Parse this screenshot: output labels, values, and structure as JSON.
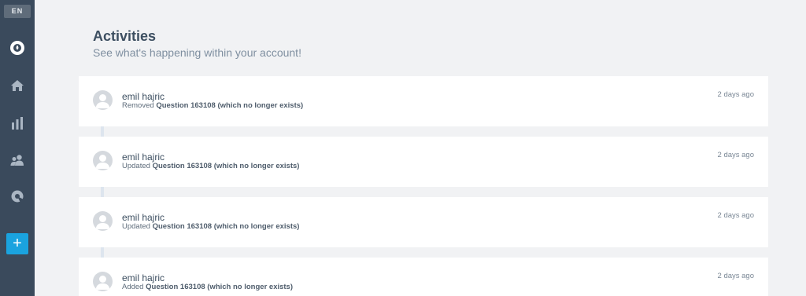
{
  "sidebar": {
    "lang": "EN",
    "items": [
      {
        "icon": "logo-icon"
      },
      {
        "icon": "home-icon"
      },
      {
        "icon": "bar-chart-icon"
      },
      {
        "icon": "users-icon"
      },
      {
        "icon": "settings-icon"
      }
    ],
    "add_label": "+"
  },
  "header": {
    "title": "Activities",
    "subtitle": "See what's happening within your account!"
  },
  "activities": [
    {
      "user": "emil hajric",
      "action": "Removed",
      "target": "Question 163108 (which no longer exists)",
      "time": "2 days ago"
    },
    {
      "user": "emil hajric",
      "action": "Updated",
      "target": "Question 163108 (which no longer exists)",
      "time": "2 days ago"
    },
    {
      "user": "emil hajric",
      "action": "Updated",
      "target": "Question 163108 (which no longer exists)",
      "time": "2 days ago"
    },
    {
      "user": "emil hajric",
      "action": "Added",
      "target": "Question 163108 (which no longer exists)",
      "time": "2 days ago"
    }
  ],
  "colors": {
    "sidebar_bg": "#3a4a5c",
    "accent": "#1aa3df",
    "page_bg": "#f1f2f4"
  }
}
